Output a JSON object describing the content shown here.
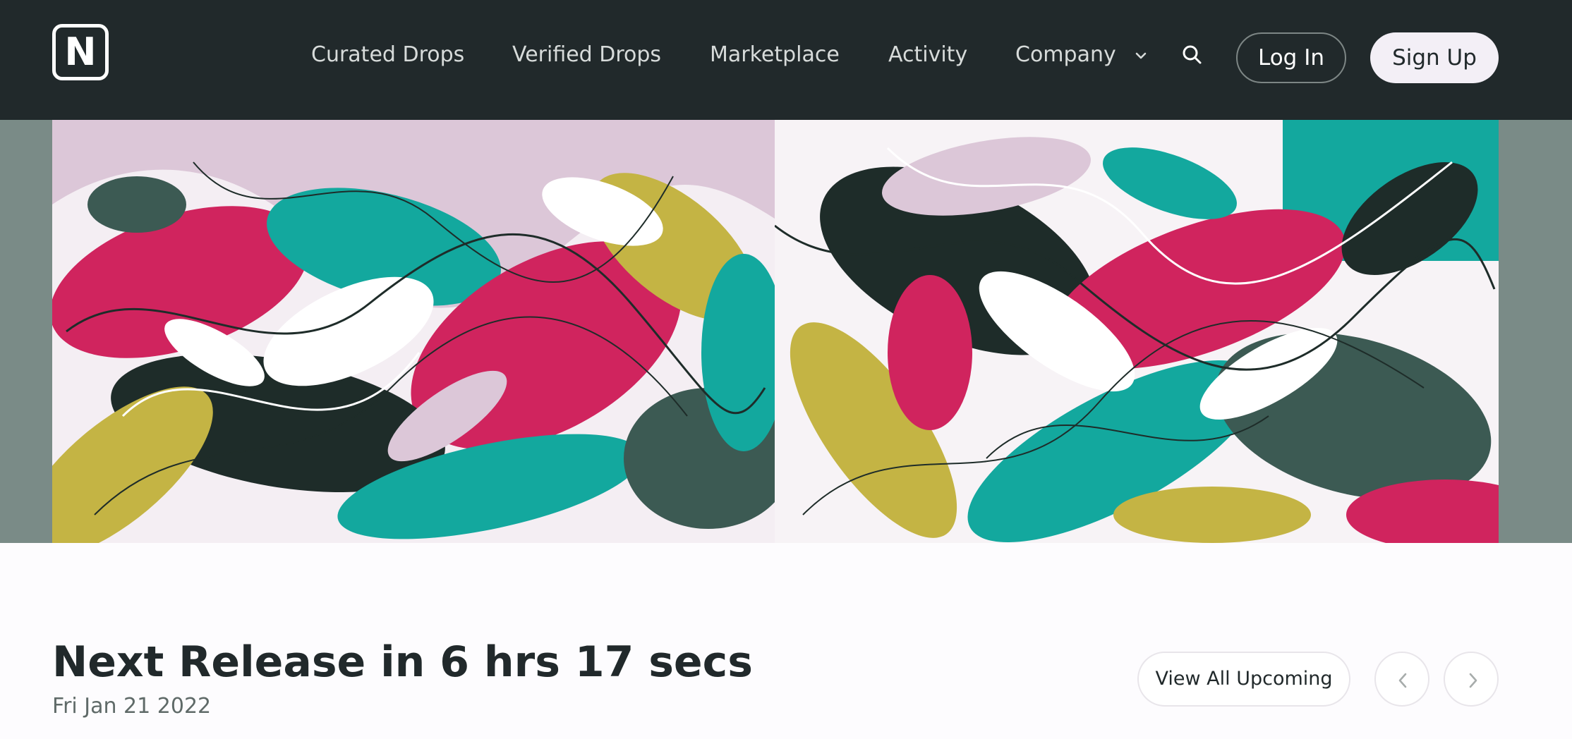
{
  "header": {
    "logo_letter": "N",
    "nav": [
      {
        "label": "Curated Drops"
      },
      {
        "label": "Verified Drops"
      },
      {
        "label": "Marketplace"
      },
      {
        "label": "Activity"
      },
      {
        "label": "Company"
      }
    ],
    "login_label": "Log In",
    "signup_label": "Sign Up",
    "icons": {
      "company_dropdown": "chevron-down-icon",
      "search": "search-icon"
    }
  },
  "release": {
    "title": "Next Release in 6 hrs 17 secs",
    "date": "Fri Jan 21 2022",
    "view_all_label": "View All Upcoming",
    "prev_icon": "chevron-left-icon",
    "next_icon": "chevron-right-icon"
  },
  "colors": {
    "header_bg": "#21292b",
    "page_bg": "#fdfcfe",
    "art_magenta": "#d0245e",
    "art_teal": "#13a89e",
    "art_olive": "#c4b444",
    "art_dark": "#1e2c29",
    "art_pink": "#dcc7d8"
  }
}
